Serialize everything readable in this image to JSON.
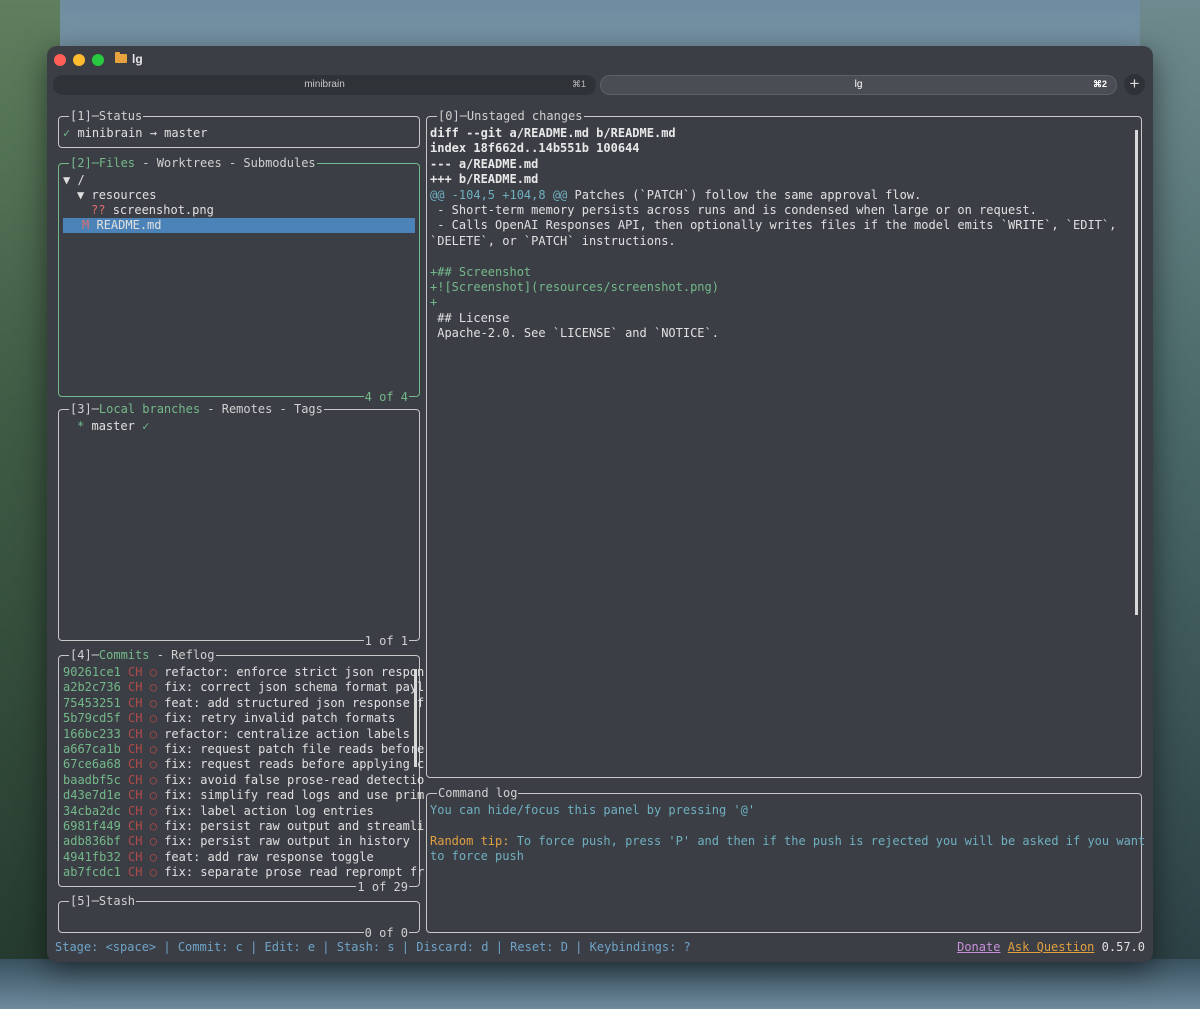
{
  "window": {
    "title": "lg"
  },
  "tabs": [
    {
      "label": "minibrain",
      "shortcut": "⌘1"
    },
    {
      "label": "lg",
      "shortcut": "⌘2"
    }
  ],
  "new_tab_label": "+",
  "status_panel": {
    "title": "[1]─Status",
    "text": "✓ minibrain → master"
  },
  "files_panel": {
    "title_prefix": "[2]─",
    "title_active": "Files",
    "title_rest": " - Worktrees - Submodules",
    "footer": "4 of 4",
    "rows": [
      {
        "marker": "▼",
        "name": "/"
      },
      {
        "marker": "▼",
        "name": "resources"
      },
      {
        "status": "??",
        "name": "screenshot.png"
      },
      {
        "status": "M",
        "name": "README.md"
      }
    ]
  },
  "branches_panel": {
    "title_prefix": "[3]─",
    "title_active": "Local branches",
    "title_rest": " - Remotes - Tags",
    "footer": "1 of 1",
    "branch": {
      "marker": "*",
      "name": "master",
      "check": "✓"
    }
  },
  "commits_panel": {
    "title_prefix": "[4]─",
    "title_active": "Commits",
    "title_rest": " - Reflog",
    "footer": "1 of 29",
    "author": "CH",
    "node": "○",
    "rows": [
      {
        "hash": "90261ce1",
        "msg": "refactor: enforce strict json respon"
      },
      {
        "hash": "a2b2c736",
        "msg": "fix: correct json schema format payl"
      },
      {
        "hash": "75453251",
        "msg": "feat: add structured json response f"
      },
      {
        "hash": "5b79cd5f",
        "msg": "fix: retry invalid patch formats"
      },
      {
        "hash": "166bc233",
        "msg": "refactor: centralize action labels"
      },
      {
        "hash": "a667ca1b",
        "msg": "fix: request patch file reads before"
      },
      {
        "hash": "67ce6a68",
        "msg": "fix: request reads before applying c"
      },
      {
        "hash": "baadbf5c",
        "msg": "fix: avoid false prose-read detectio"
      },
      {
        "hash": "d43e7d1e",
        "msg": "fix: simplify read logs and use prim"
      },
      {
        "hash": "34cba2dc",
        "msg": "fix: label action log entries"
      },
      {
        "hash": "6981f449",
        "msg": "fix: persist raw output and streamli"
      },
      {
        "hash": "adb836bf",
        "msg": "fix: persist raw output in history"
      },
      {
        "hash": "4941fb32",
        "msg": "feat: add raw response toggle"
      },
      {
        "hash": "ab7fcdc1",
        "msg": "fix: separate prose read reprompt fr"
      }
    ]
  },
  "stash_panel": {
    "title": "[5]─Stash",
    "footer": "0 of 0"
  },
  "diff_panel": {
    "title": "[0]─Unstaged changes",
    "lines": [
      {
        "kind": "bold",
        "text": "diff --git a/README.md b/README.md"
      },
      {
        "kind": "bold",
        "text": "index 18f662d..14b551b 100644"
      },
      {
        "kind": "bold",
        "text": "--- a/README.md"
      },
      {
        "kind": "bold",
        "text": "+++ b/README.md"
      },
      {
        "kind": "hunk",
        "text": "@@ -104,5 +104,8 @@",
        "rest": " Patches (`PATCH`) follow the same approval flow."
      },
      {
        "kind": "ctx",
        "text": " - Short-term memory persists across runs and is condensed when large or on request."
      },
      {
        "kind": "ctx",
        "text": " - Calls OpenAI Responses API, then optionally writes files if the model emits `WRITE`, `EDIT`,"
      },
      {
        "kind": "ctx",
        "text": "`DELETE`, or `PATCH` instructions."
      },
      {
        "kind": "ctx",
        "text": " "
      },
      {
        "kind": "plus",
        "text": "+## Screenshot"
      },
      {
        "kind": "plus",
        "text": "+![Screenshot](resources/screenshot.png)"
      },
      {
        "kind": "plus",
        "text": "+"
      },
      {
        "kind": "ctx",
        "text": " ## License"
      },
      {
        "kind": "ctx",
        "text": " Apache-2.0. See `LICENSE` and `NOTICE`."
      }
    ]
  },
  "command_log": {
    "title": "Command log",
    "hint": "You can hide/focus this panel by pressing '@'",
    "tip_label": "Random tip:",
    "tip_text": " To force push, press 'P' and then if the push is rejected you will be asked if you want",
    "tip_text2": "to force push"
  },
  "status_bar": {
    "keybindings": "Stage: <space> | Commit: c | Edit: e | Stash: s | Discard: d | Reset: D | Keybindings: ?",
    "donate": "Donate",
    "ask": "Ask Question",
    "version": "0.57.0"
  },
  "colors": {
    "active_border": "#74b98a",
    "selection": "#4b83b8",
    "hint_text": "#6fb0c0",
    "tip_label": "#e0a040"
  }
}
